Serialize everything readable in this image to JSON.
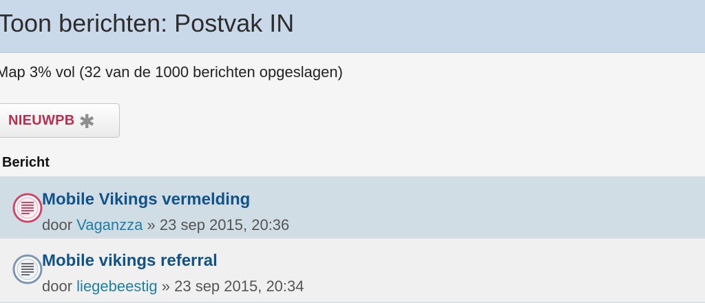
{
  "header": {
    "title": "Toon berichten: Postvak IN"
  },
  "folder": {
    "status": "Map 3% vol (32 van de 1000 berichten opgeslagen)"
  },
  "toolbar": {
    "new_pm_label": "NIEUWPB",
    "new_pm_icon": "star-icon"
  },
  "list": {
    "column_header": "Bericht",
    "messages": [
      {
        "title": "Mobile Vikings vermelding",
        "by_label": "door",
        "author": "Vaganzza",
        "separator": "»",
        "date": "23 sep 2015, 20:36",
        "icon": "unread-message-icon",
        "icon_color": "#d04665"
      },
      {
        "title": "Mobile vikings referral",
        "by_label": "door",
        "author": "liegebeestig",
        "separator": "»",
        "date": "23 sep 2015, 20:34",
        "icon": "read-message-icon",
        "icon_color": "#7b95b5"
      }
    ]
  },
  "colors": {
    "header_bg": "#c9d9e9",
    "title_link": "#105289",
    "author_link": "#1f7ea5",
    "button_text": "#bb2d4e",
    "highlight_row": "#d0dde4"
  }
}
